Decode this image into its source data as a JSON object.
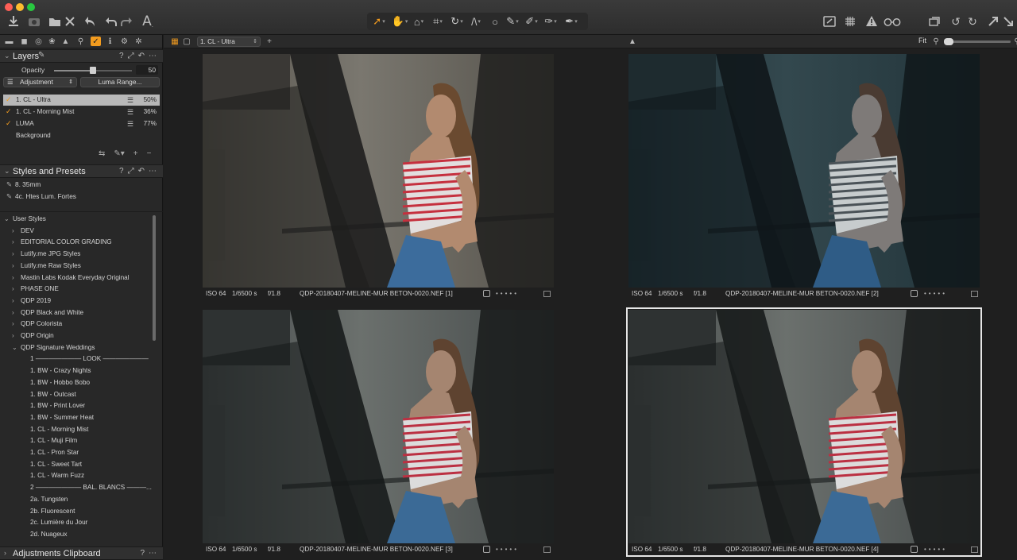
{
  "toolbar": {
    "left_icons": [
      "import-icon",
      "camera-icon",
      "export-icon",
      "delete-icon",
      "undo-history-icon",
      "undo-icon",
      "redo-icon",
      "text-annotation-icon"
    ],
    "cursor_tools": [
      "select-cursor-icon",
      "pan-icon",
      "loupe-icon",
      "crop-icon",
      "rotate-icon",
      "keystone-icon",
      "circle-mask-icon",
      "brush-icon",
      "erase-icon",
      "gradient-icon",
      "eyedropper-icon"
    ],
    "right_icons": [
      "proof-icon",
      "grid-icon",
      "warning-icon",
      "glasses-icon",
      "stack-icon",
      "rotate-left-icon",
      "rotate-right-icon",
      "cursor-pick-icon"
    ]
  },
  "layers": {
    "title": "Layers",
    "opacity_label": "Opacity",
    "opacity_value": "50",
    "opacity_fraction": 0.5,
    "adjustment_label": "Adjustment",
    "luma_button": "Luma Range...",
    "items": [
      {
        "name": "1. CL - Ultra",
        "opacity": "50%",
        "checked": true,
        "selected": true
      },
      {
        "name": "1. CL - Morning Mist",
        "opacity": "36%",
        "checked": true,
        "selected": false
      },
      {
        "name": "LUMA",
        "opacity": "77%",
        "checked": true,
        "selected": false
      },
      {
        "name": "Background",
        "opacity": "",
        "checked": false,
        "selected": false
      }
    ]
  },
  "styles": {
    "title": "Styles and Presets",
    "applied": [
      "8. 35mm",
      "4c. Htes Lum. Fortes"
    ],
    "user_styles_label": "User Styles",
    "folders": [
      "DEV",
      "EDITORIAL COLOR GRADING",
      "Lutify.me JPG Styles",
      "Lutify.me Raw Styles",
      "Mastin Labs Kodak Everyday Original",
      "PHASE ONE",
      "QDP 2019",
      "QDP Black and White",
      "QDP Colorista",
      "QDP Origin"
    ],
    "open_folder": "QDP Signature Weddings",
    "children": [
      "1 ——————— LOOK ———————",
      "1. BW - Crazy Nights",
      "1. BW - Hobbo Bobo",
      "1. BW - Outcast",
      "1. BW - Print Lover",
      "1. BW - Summer Heat",
      "1. CL - Morning Mist",
      "1. CL - Muji Film",
      "1. CL - Pron Star",
      "1. CL - Sweet Tart",
      "1. CL - Warm Fuzz",
      "2 ——————— BAL. BLANCS ———...",
      "2a. Tungsten",
      "2b. Fluorescent",
      "2c. Lumière du Jour",
      "2d. Nuageux"
    ]
  },
  "clipboard": {
    "title": "Adjustments Clipboard"
  },
  "viewer": {
    "variant_select": "1. CL - Ultra",
    "fit_label": "Fit",
    "zoom_fraction": 0.0,
    "images": [
      {
        "iso": "ISO 64",
        "shutter": "1/6500 s",
        "aperture": "f/1.8",
        "file": "QDP-20180407-MELINE-MUR BETON-0020.NEF [1]",
        "tone": "warm",
        "selected": false
      },
      {
        "iso": "ISO 64",
        "shutter": "1/6500 s",
        "aperture": "f/1.8",
        "file": "QDP-20180407-MELINE-MUR BETON-0020.NEF [2]",
        "tone": "teal",
        "selected": false
      },
      {
        "iso": "ISO 64",
        "shutter": "1/6500 s",
        "aperture": "f/1.8",
        "file": "QDP-20180407-MELINE-MUR BETON-0020.NEF [3]",
        "tone": "cool",
        "selected": false
      },
      {
        "iso": "ISO 64",
        "shutter": "1/6500 s",
        "aperture": "f/1.8",
        "file": "QDP-20180407-MELINE-MUR BETON-0020.NEF [4]",
        "tone": "cool",
        "selected": true
      }
    ]
  },
  "colors": {
    "accent": "#f39c1f",
    "panel": "#282828",
    "viewer": "#1f1f1f"
  }
}
